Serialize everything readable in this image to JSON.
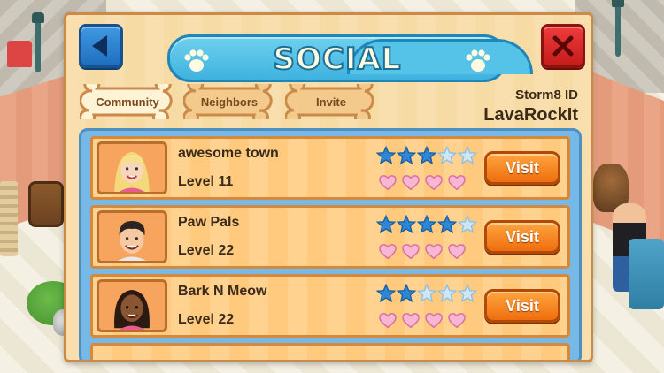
{
  "header": {
    "title": "SOCIAL",
    "back_icon": "back-arrow-icon",
    "close_icon": "close-x-icon"
  },
  "tabs": [
    {
      "label": "Community",
      "active": true
    },
    {
      "label": "Neighbors",
      "active": false
    },
    {
      "label": "Invite",
      "active": false
    }
  ],
  "storm8": {
    "label": "Storm8 ID",
    "value": "LavaRockIt"
  },
  "players": [
    {
      "name": "awesome town",
      "level": "Level 11",
      "stars": 3,
      "hearts": 4,
      "visit_label": "Visit",
      "avatar": "blonde-woman-avatar"
    },
    {
      "name": "Paw Pals",
      "level": "Level 22",
      "stars": 4,
      "hearts": 4,
      "visit_label": "Visit",
      "avatar": "dark-haired-man-avatar"
    },
    {
      "name": "Bark N Meow",
      "level": "Level 22",
      "stars": 2,
      "hearts": 4,
      "visit_label": "Visit",
      "avatar": "dark-skinned-woman-avatar"
    }
  ],
  "colors": {
    "panel": "#f7dba4",
    "banner": "#3fb2df",
    "visit": "#ee6e0f",
    "star_on": "#2e86d6",
    "star_off": "#cfe6f7",
    "heart": "#f7b6d3"
  }
}
